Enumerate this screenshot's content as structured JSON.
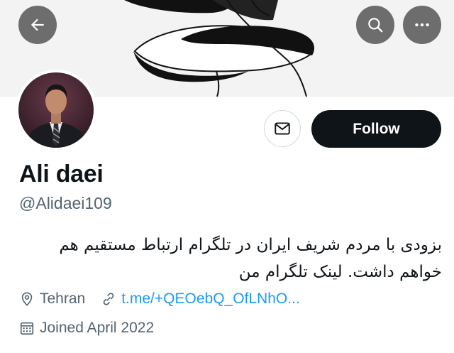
{
  "header": {
    "back_icon": "arrow-left-icon",
    "search_icon": "search-icon",
    "more_icon": "more-horizontal-icon"
  },
  "profile": {
    "display_name": "Ali daei",
    "handle": "@Alidaei109",
    "bio": "بزودی با مردم شریف ایران در تلگرام ارتباط مستقیم هم خواهم داشت. لینک تلگرام من",
    "location": "Tehran",
    "link": "t.me/+QEOebQ_OfLNhO...",
    "joined": "Joined April 2022"
  },
  "actions": {
    "message_icon": "envelope-icon",
    "follow_label": "Follow"
  },
  "colors": {
    "follow_bg": "#0f1419",
    "link": "#1d9bf0",
    "secondary_text": "#536471"
  }
}
